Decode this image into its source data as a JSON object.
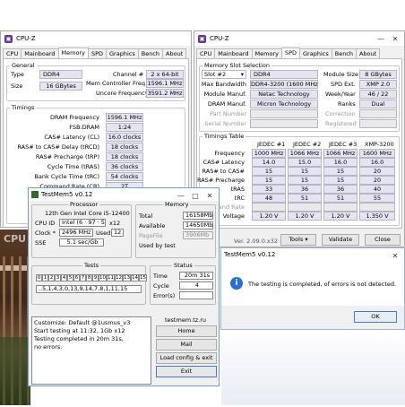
{
  "left_window": {
    "title": "CPU-Z",
    "tabs": [
      "CPU",
      "Mainboard",
      "Memory",
      "SPD",
      "Graphics",
      "Bench",
      "About"
    ],
    "general": {
      "legend": "General",
      "type_label": "Type",
      "type_value": "DDR4",
      "size_label": "Size",
      "size_value": "16 GBytes",
      "channel_label": "Channel #",
      "channel_value": "2 x 64-bit",
      "mcf_label": "Mem Controller Freq.",
      "mcf_value": "1596.1 MHz",
      "uncore_label": "Uncore Frequency",
      "uncore_value": "3591.2 MHz"
    },
    "timings": {
      "legend": "Timings",
      "rows": [
        {
          "label": "DRAM Frequency",
          "value": "1596.1 MHz"
        },
        {
          "label": "FSB:DRAM",
          "value": "1:24"
        },
        {
          "label": "CAS# Latency (CL)",
          "value": "16.0 clocks"
        },
        {
          "label": "RAS# to CAS# Delay (tRCD)",
          "value": "18 clocks"
        },
        {
          "label": "RAS# Precharge (tRP)",
          "value": "18 clocks"
        },
        {
          "label": "Cycle Time (tRAS)",
          "value": "36 clocks"
        },
        {
          "label": "Bank Cycle Time (tRC)",
          "value": "54 clocks"
        },
        {
          "label": "Command Rate (CR)",
          "value": "2T"
        }
      ]
    },
    "bottom_text": "CPU"
  },
  "right_window": {
    "title": "CPU-Z",
    "tabs": [
      "CPU",
      "Mainboard",
      "Memory",
      "SPD",
      "Graphics",
      "Bench",
      "About"
    ],
    "slot_legend": "Memory Slot Selection",
    "slot_value": "Slot #2",
    "ddr_type": "DDR4",
    "module_size_label": "Module Size",
    "module_size_value": "8 GBytes",
    "max_bw_label": "Max Bandwidth",
    "max_bw_value": "DDR4-3200 (1600 MHz)",
    "spd_ext_label": "SPD Ext.",
    "spd_ext_value": "XMP 2.0",
    "module_manuf_label": "Module Manuf.",
    "module_manuf_value": "Netac Technology",
    "week_year_label": "Week/Year",
    "week_year_value": "46 / 22",
    "dram_manuf_label": "DRAM Manuf.",
    "dram_manuf_value": "Micron Technology",
    "ranks_label": "Ranks",
    "ranks_value": "Dual",
    "part_label": "Part Number",
    "correction_label": "Correction",
    "serial_label": "Serial Number",
    "registered_label": "Registered",
    "timings_legend": "Timings Table",
    "col_headers": [
      "JEDEC #1",
      "JEDEC #2",
      "JEDEC #3",
      "XMP-3200"
    ],
    "rows": [
      {
        "label": "Frequency",
        "values": [
          "1000 MHz",
          "1066 MHz",
          "1066 MHz",
          "1600 MHz"
        ]
      },
      {
        "label": "CAS# Latency",
        "values": [
          "14.0",
          "15.0",
          "16.0",
          "16.0"
        ]
      },
      {
        "label": "RAS# to CAS#",
        "values": [
          "15",
          "15",
          "15",
          "20"
        ]
      },
      {
        "label": "RAS# Precharge",
        "values": [
          "15",
          "15",
          "15",
          "20"
        ]
      },
      {
        "label": "tRAS",
        "values": [
          "33",
          "36",
          "36",
          "40"
        ]
      },
      {
        "label": "tRC",
        "values": [
          "48",
          "51",
          "51",
          "55"
        ]
      },
      {
        "label": "Command Rate",
        "values": [
          "",
          "",
          "",
          ""
        ]
      },
      {
        "label": "Voltage",
        "values": [
          "1.20 V",
          "1.20 V",
          "1.20 V",
          "1.350 V"
        ]
      }
    ],
    "version": "Ver. 2.09.0.x32",
    "tools_label": "Tools",
    "validate_label": "Validate",
    "close_label": "Close"
  },
  "testmem": {
    "title": "TestMem5 v0.12",
    "processor_legend": "Processor",
    "processor_name": "12th Gen Intel Core i5-12400",
    "cpu_id_label": "CPU ID",
    "cpu_id_value": "Intel  (6 · 97 · 5)",
    "cpu_id_x": "x12",
    "clock_label": "Clock *",
    "clock_value": "2496 MHz",
    "used_label": "Used",
    "used_value": "12",
    "sse_label": "SSE",
    "sse_value": "5.1 sec/Gb",
    "memory_legend": "Memory",
    "total_label": "Total",
    "total_value": "16158Mb",
    "available_label": "Available",
    "available_value": "14650Mb",
    "pagefile_label": "PageFile",
    "pagefile_value": "3906Mb",
    "used_by_test_label": "Used by test",
    "tests_legend": "Tests",
    "test_cells": [
      "0",
      "1",
      "2",
      "3",
      "4",
      "5",
      "6",
      "7",
      "8",
      "9",
      "10",
      "11",
      "12",
      "13",
      "14",
      "15"
    ],
    "test_sequence": "..5,1,4,3,0,13,9,14,7,8,1,11,15",
    "status_legend": "Status",
    "time_label": "Time",
    "time_value": "20m 31s",
    "cycle_label": "Cycle",
    "cycle_value": "4",
    "errors_label": "Error(s)",
    "errors_value": "",
    "log": [
      "Customize: Default @1usmus_v3",
      "Start testing at 11:32, 1Gb x12",
      "Testing completed in 20m 31s,",
      "no errors."
    ],
    "site": "testmem.tz.ru",
    "home_label": "Home",
    "mail_label": "Mail",
    "load_label": "Load config & exit",
    "exit_label": "Exit"
  },
  "dialog": {
    "title": "TestMem5 v0.12",
    "message": "The testing is completed, of errors is not detected.",
    "ok_label": "OK"
  }
}
